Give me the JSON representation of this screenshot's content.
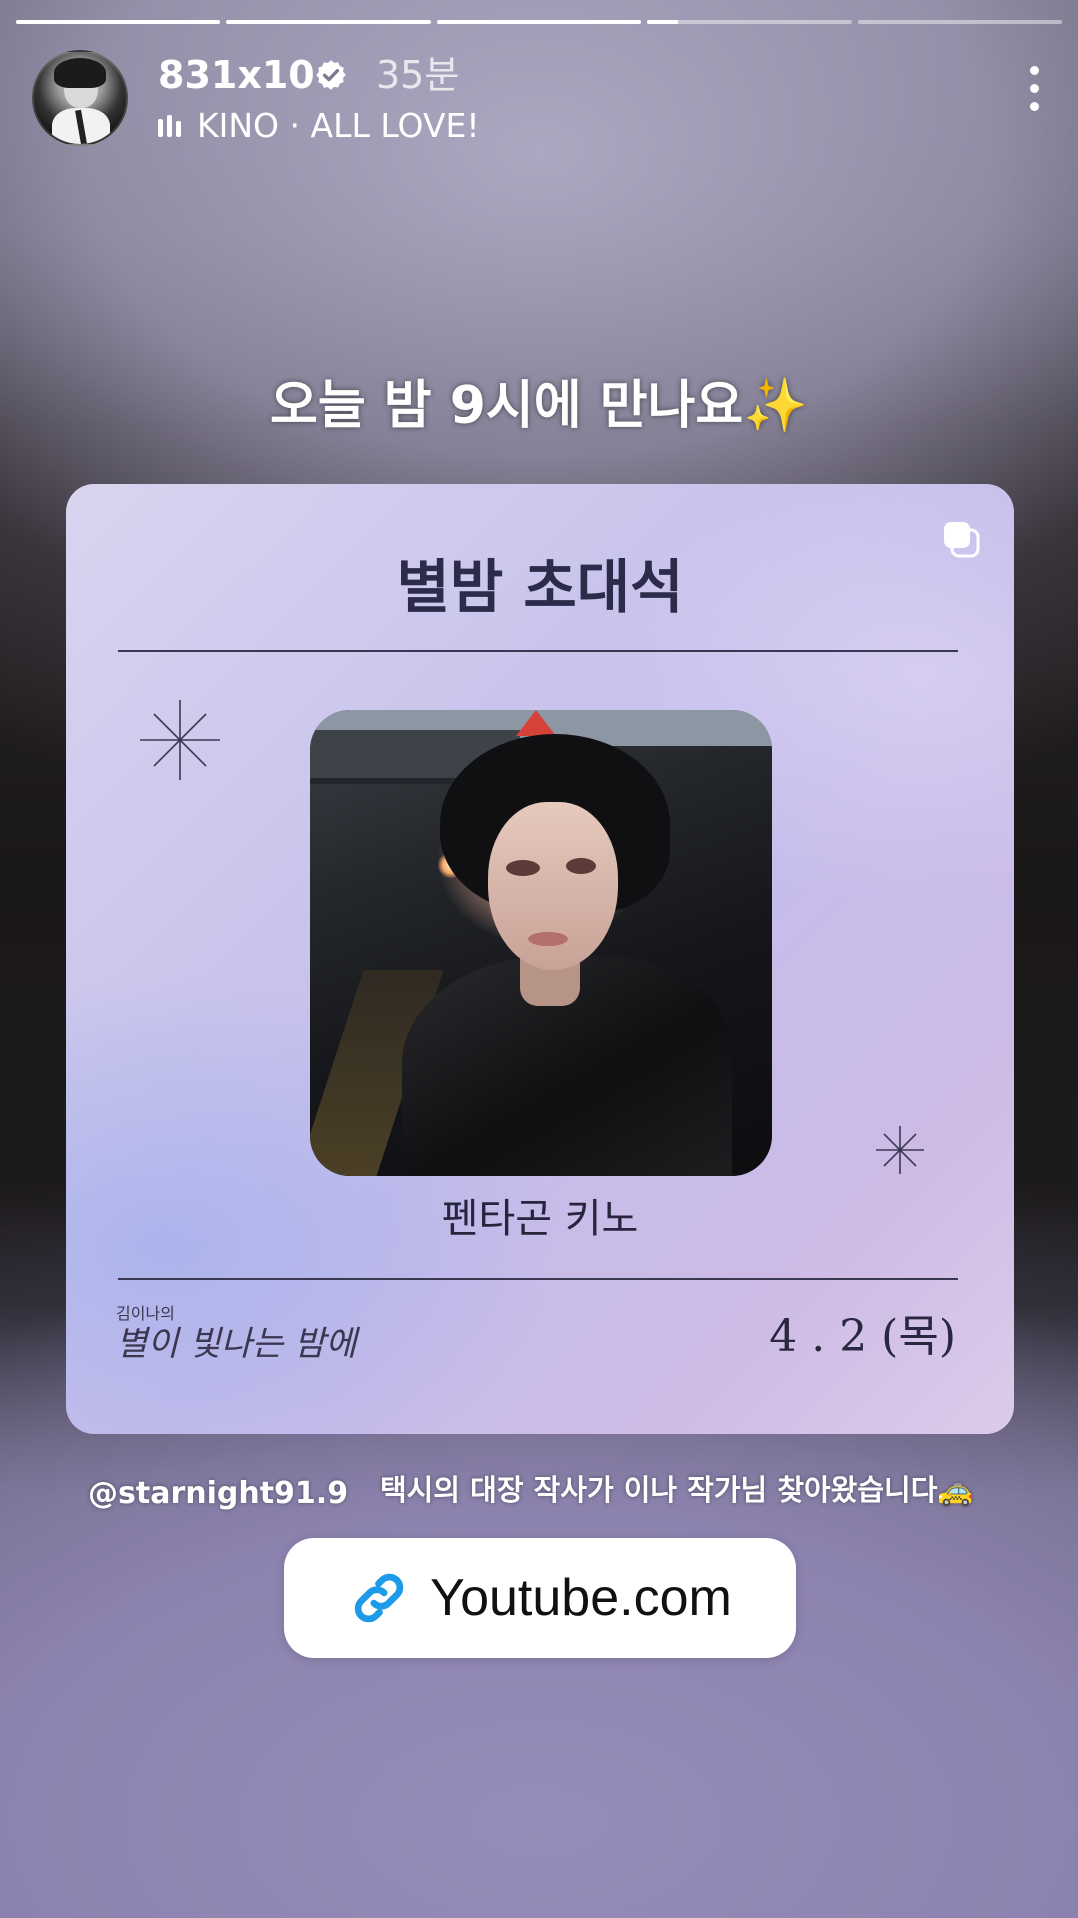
{
  "story": {
    "progress_segments": [
      1,
      1,
      1,
      0.15,
      0
    ],
    "username": "831x10",
    "time_ago": "35분",
    "music": "KINO · ALL LOVE!",
    "caption": "오늘 밤 9시에 만나요✨",
    "mention": "@starnight91.9",
    "subcaption": "택시의 대장 작사가 이나 작가님 찾아왔습니다🚕"
  },
  "card": {
    "title": "별밤 초대석",
    "guest_name": "펜타곤 키노",
    "brand_small": "김이나의",
    "brand_big": "별이 빛나는 밤에",
    "date": "4 . 2 (목)"
  },
  "link": {
    "label": "Youtube.com"
  },
  "colors": {
    "link_icon": "#1d9be8",
    "card_title": "#2c2b4a"
  }
}
